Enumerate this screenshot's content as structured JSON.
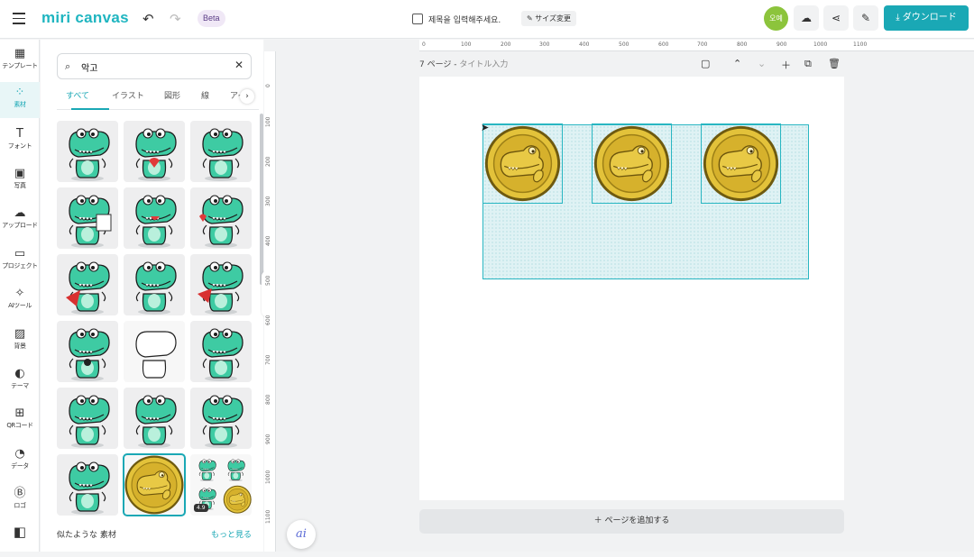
{
  "app": {
    "logo": "miri canvas",
    "beta": "Beta",
    "doc_title": "제목을 입력해주세요.",
    "size_change": "サイズ変更",
    "avatar": "오예",
    "download": "ダウンロード"
  },
  "nav": [
    {
      "label": "テンプレート",
      "icon": "template-icon"
    },
    {
      "label": "素材",
      "icon": "elements-icon"
    },
    {
      "label": "フォント",
      "icon": "text-icon"
    },
    {
      "label": "写真",
      "icon": "photo-icon"
    },
    {
      "label": "アップロード",
      "icon": "upload-icon"
    },
    {
      "label": "プロジェクト",
      "icon": "folder-icon"
    },
    {
      "label": "AIツール",
      "icon": "sparkle-icon"
    },
    {
      "label": "背景",
      "icon": "background-icon"
    },
    {
      "label": "テーマ",
      "icon": "palette-icon"
    },
    {
      "label": "QRコード",
      "icon": "qr-icon"
    },
    {
      "label": "データ",
      "icon": "chart-icon"
    },
    {
      "label": "ロゴ",
      "icon": "logo-b-icon"
    },
    {
      "label": "",
      "icon": "brand-icon"
    }
  ],
  "panel": {
    "search_value": "악고",
    "tabs": [
      "すべて",
      "イラスト",
      "図形",
      "線",
      "アイ"
    ],
    "gif_badge": "4.9",
    "similar_label": "似たような 素材",
    "more_label": "もっと見る"
  },
  "canvas": {
    "ruler_h": [
      "0",
      "100",
      "200",
      "300",
      "400",
      "500",
      "600",
      "700",
      "800",
      "900",
      "1000",
      "1100"
    ],
    "ruler_v": [
      "0",
      "100",
      "200",
      "300",
      "400",
      "500",
      "600",
      "700",
      "800",
      "900",
      "1000",
      "1100"
    ],
    "page_label": "7 ページ - ",
    "page_title_placeholder": "タイトル入力",
    "add_page": "ページを追加する",
    "ai_label": "ai"
  },
  "colors": {
    "accent": "#1aa8b5",
    "croc": "#3ecba3",
    "coin": "#e3c23a"
  }
}
